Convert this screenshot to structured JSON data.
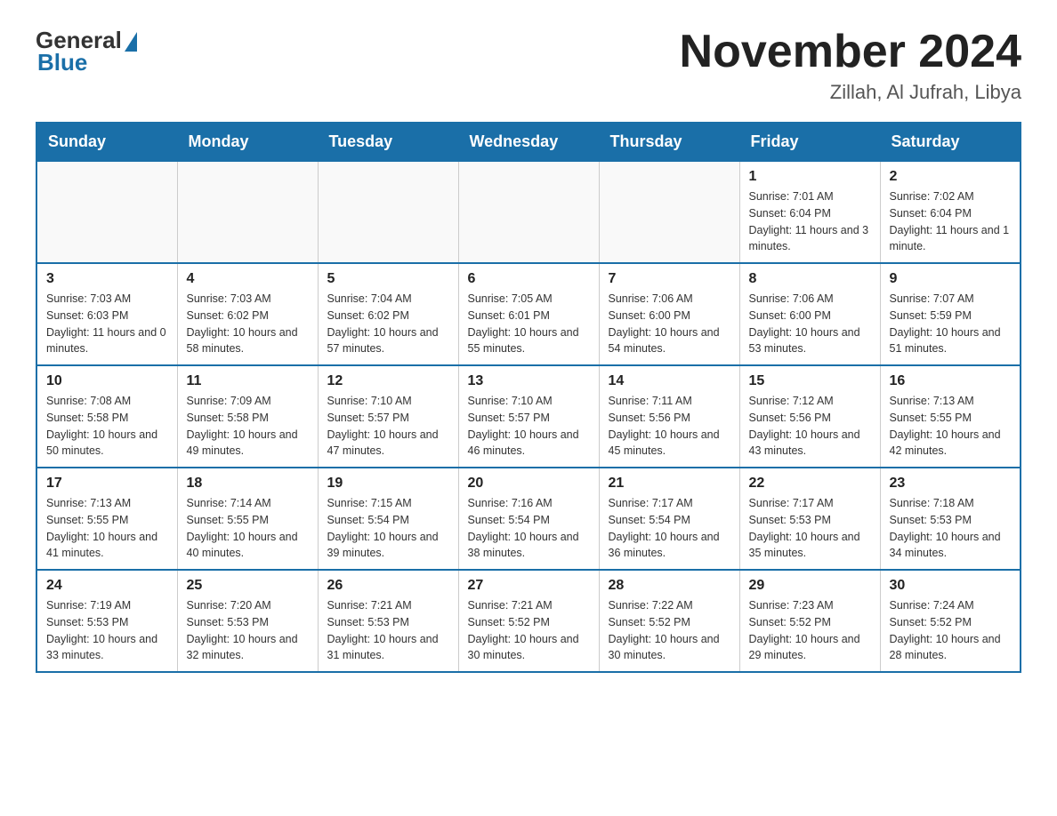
{
  "header": {
    "logo_general": "General",
    "logo_blue": "Blue",
    "month_title": "November 2024",
    "location": "Zillah, Al Jufrah, Libya"
  },
  "weekdays": [
    "Sunday",
    "Monday",
    "Tuesday",
    "Wednesday",
    "Thursday",
    "Friday",
    "Saturday"
  ],
  "weeks": [
    [
      {
        "day": "",
        "sunrise": "",
        "sunset": "",
        "daylight": ""
      },
      {
        "day": "",
        "sunrise": "",
        "sunset": "",
        "daylight": ""
      },
      {
        "day": "",
        "sunrise": "",
        "sunset": "",
        "daylight": ""
      },
      {
        "day": "",
        "sunrise": "",
        "sunset": "",
        "daylight": ""
      },
      {
        "day": "",
        "sunrise": "",
        "sunset": "",
        "daylight": ""
      },
      {
        "day": "1",
        "sunrise": "Sunrise: 7:01 AM",
        "sunset": "Sunset: 6:04 PM",
        "daylight": "Daylight: 11 hours and 3 minutes."
      },
      {
        "day": "2",
        "sunrise": "Sunrise: 7:02 AM",
        "sunset": "Sunset: 6:04 PM",
        "daylight": "Daylight: 11 hours and 1 minute."
      }
    ],
    [
      {
        "day": "3",
        "sunrise": "Sunrise: 7:03 AM",
        "sunset": "Sunset: 6:03 PM",
        "daylight": "Daylight: 11 hours and 0 minutes."
      },
      {
        "day": "4",
        "sunrise": "Sunrise: 7:03 AM",
        "sunset": "Sunset: 6:02 PM",
        "daylight": "Daylight: 10 hours and 58 minutes."
      },
      {
        "day": "5",
        "sunrise": "Sunrise: 7:04 AM",
        "sunset": "Sunset: 6:02 PM",
        "daylight": "Daylight: 10 hours and 57 minutes."
      },
      {
        "day": "6",
        "sunrise": "Sunrise: 7:05 AM",
        "sunset": "Sunset: 6:01 PM",
        "daylight": "Daylight: 10 hours and 55 minutes."
      },
      {
        "day": "7",
        "sunrise": "Sunrise: 7:06 AM",
        "sunset": "Sunset: 6:00 PM",
        "daylight": "Daylight: 10 hours and 54 minutes."
      },
      {
        "day": "8",
        "sunrise": "Sunrise: 7:06 AM",
        "sunset": "Sunset: 6:00 PM",
        "daylight": "Daylight: 10 hours and 53 minutes."
      },
      {
        "day": "9",
        "sunrise": "Sunrise: 7:07 AM",
        "sunset": "Sunset: 5:59 PM",
        "daylight": "Daylight: 10 hours and 51 minutes."
      }
    ],
    [
      {
        "day": "10",
        "sunrise": "Sunrise: 7:08 AM",
        "sunset": "Sunset: 5:58 PM",
        "daylight": "Daylight: 10 hours and 50 minutes."
      },
      {
        "day": "11",
        "sunrise": "Sunrise: 7:09 AM",
        "sunset": "Sunset: 5:58 PM",
        "daylight": "Daylight: 10 hours and 49 minutes."
      },
      {
        "day": "12",
        "sunrise": "Sunrise: 7:10 AM",
        "sunset": "Sunset: 5:57 PM",
        "daylight": "Daylight: 10 hours and 47 minutes."
      },
      {
        "day": "13",
        "sunrise": "Sunrise: 7:10 AM",
        "sunset": "Sunset: 5:57 PM",
        "daylight": "Daylight: 10 hours and 46 minutes."
      },
      {
        "day": "14",
        "sunrise": "Sunrise: 7:11 AM",
        "sunset": "Sunset: 5:56 PM",
        "daylight": "Daylight: 10 hours and 45 minutes."
      },
      {
        "day": "15",
        "sunrise": "Sunrise: 7:12 AM",
        "sunset": "Sunset: 5:56 PM",
        "daylight": "Daylight: 10 hours and 43 minutes."
      },
      {
        "day": "16",
        "sunrise": "Sunrise: 7:13 AM",
        "sunset": "Sunset: 5:55 PM",
        "daylight": "Daylight: 10 hours and 42 minutes."
      }
    ],
    [
      {
        "day": "17",
        "sunrise": "Sunrise: 7:13 AM",
        "sunset": "Sunset: 5:55 PM",
        "daylight": "Daylight: 10 hours and 41 minutes."
      },
      {
        "day": "18",
        "sunrise": "Sunrise: 7:14 AM",
        "sunset": "Sunset: 5:55 PM",
        "daylight": "Daylight: 10 hours and 40 minutes."
      },
      {
        "day": "19",
        "sunrise": "Sunrise: 7:15 AM",
        "sunset": "Sunset: 5:54 PM",
        "daylight": "Daylight: 10 hours and 39 minutes."
      },
      {
        "day": "20",
        "sunrise": "Sunrise: 7:16 AM",
        "sunset": "Sunset: 5:54 PM",
        "daylight": "Daylight: 10 hours and 38 minutes."
      },
      {
        "day": "21",
        "sunrise": "Sunrise: 7:17 AM",
        "sunset": "Sunset: 5:54 PM",
        "daylight": "Daylight: 10 hours and 36 minutes."
      },
      {
        "day": "22",
        "sunrise": "Sunrise: 7:17 AM",
        "sunset": "Sunset: 5:53 PM",
        "daylight": "Daylight: 10 hours and 35 minutes."
      },
      {
        "day": "23",
        "sunrise": "Sunrise: 7:18 AM",
        "sunset": "Sunset: 5:53 PM",
        "daylight": "Daylight: 10 hours and 34 minutes."
      }
    ],
    [
      {
        "day": "24",
        "sunrise": "Sunrise: 7:19 AM",
        "sunset": "Sunset: 5:53 PM",
        "daylight": "Daylight: 10 hours and 33 minutes."
      },
      {
        "day": "25",
        "sunrise": "Sunrise: 7:20 AM",
        "sunset": "Sunset: 5:53 PM",
        "daylight": "Daylight: 10 hours and 32 minutes."
      },
      {
        "day": "26",
        "sunrise": "Sunrise: 7:21 AM",
        "sunset": "Sunset: 5:53 PM",
        "daylight": "Daylight: 10 hours and 31 minutes."
      },
      {
        "day": "27",
        "sunrise": "Sunrise: 7:21 AM",
        "sunset": "Sunset: 5:52 PM",
        "daylight": "Daylight: 10 hours and 30 minutes."
      },
      {
        "day": "28",
        "sunrise": "Sunrise: 7:22 AM",
        "sunset": "Sunset: 5:52 PM",
        "daylight": "Daylight: 10 hours and 30 minutes."
      },
      {
        "day": "29",
        "sunrise": "Sunrise: 7:23 AM",
        "sunset": "Sunset: 5:52 PM",
        "daylight": "Daylight: 10 hours and 29 minutes."
      },
      {
        "day": "30",
        "sunrise": "Sunrise: 7:24 AM",
        "sunset": "Sunset: 5:52 PM",
        "daylight": "Daylight: 10 hours and 28 minutes."
      }
    ]
  ]
}
